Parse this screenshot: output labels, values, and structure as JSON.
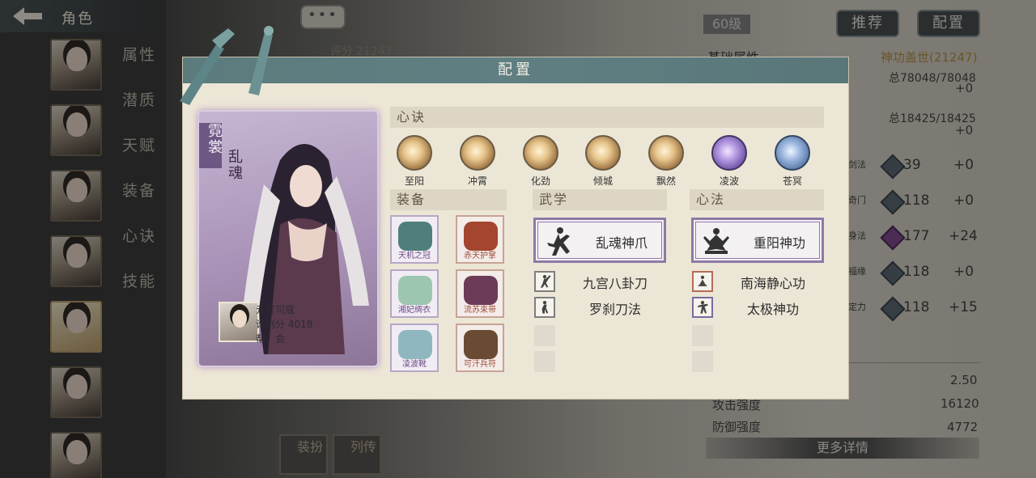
{
  "header": {
    "back_title": "角色"
  },
  "side_menu": [
    "属性",
    "潜质",
    "天赋",
    "装备",
    "心诀",
    "技能"
  ],
  "chat": {
    "label": "•••"
  },
  "background": {
    "score_label": "评分",
    "score_value": "21247",
    "level": "60级",
    "recommend_label": "推荐",
    "config_label": "配置",
    "base_attr_label": "基础属性",
    "title_badge": "神功盖世(21247)",
    "hp": "总78048/78048",
    "hp_bonus": "+0",
    "mp": "总18425/18425",
    "mp_bonus": "+0",
    "stats": [
      {
        "name": "剑法",
        "value": "39",
        "bonus": "+0"
      },
      {
        "name": "奇门",
        "value": "118",
        "bonus": "+0"
      },
      {
        "name": "身法",
        "value": "177",
        "bonus": "+24"
      },
      {
        "name": "福缘",
        "value": "118",
        "bonus": "+0"
      },
      {
        "name": "定力",
        "value": "118",
        "bonus": "+15"
      }
    ],
    "extra": [
      {
        "name": "",
        "value": "2.50"
      },
      {
        "name": "攻击强度",
        "value": "16120"
      },
      {
        "name": "防御强度",
        "value": "4772"
      }
    ],
    "more_details": "更多详情",
    "bottom_tabs": [
      "装扮",
      "列传"
    ]
  },
  "modal": {
    "title": "配置",
    "card": {
      "title1": "霓裳",
      "title2": "乱魂",
      "player_name": "亓官司寇",
      "score_label": "论剑分",
      "score_value": "4018",
      "guild_label": "帮　会"
    },
    "xinjue_label": "心诀",
    "xinjue": [
      {
        "name": "至阳",
        "style": "gold"
      },
      {
        "name": "冲霄",
        "style": "gold"
      },
      {
        "name": "化劲",
        "style": "gold"
      },
      {
        "name": "倾城",
        "style": "gold"
      },
      {
        "name": "飘然",
        "style": "gold"
      },
      {
        "name": "凌波",
        "style": "purple"
      },
      {
        "name": "苍冥",
        "style": "blue"
      }
    ],
    "equip_label": "装备",
    "equipment": [
      {
        "name": "天机之冠",
        "tone": "purple",
        "color": "#4e7f7c"
      },
      {
        "name": "赤天护掌",
        "tone": "red",
        "color": "#a3452f"
      },
      {
        "name": "湘妃绸衣",
        "tone": "purple",
        "color": "#9cc6b0"
      },
      {
        "name": "流苏束带",
        "tone": "red",
        "color": "#6b3b57"
      },
      {
        "name": "凌波靴",
        "tone": "purple",
        "color": "#8fb7bf"
      },
      {
        "name": "可汗兵符",
        "tone": "red",
        "color": "#6a4a32"
      }
    ],
    "wuxue_label": "武学",
    "wuxue_main": "乱魂神爪",
    "wuxue_subs": [
      "九宫八卦刀",
      "罗刹刀法"
    ],
    "xinfa_label": "心法",
    "xinfa_main": "重阳神功",
    "xinfa_subs": [
      "南海静心功",
      "太极神功"
    ]
  },
  "colors": {
    "header_teal": "#5c7b7d",
    "card_purple": "#a993b8",
    "title_gold": "#b08a3a"
  }
}
